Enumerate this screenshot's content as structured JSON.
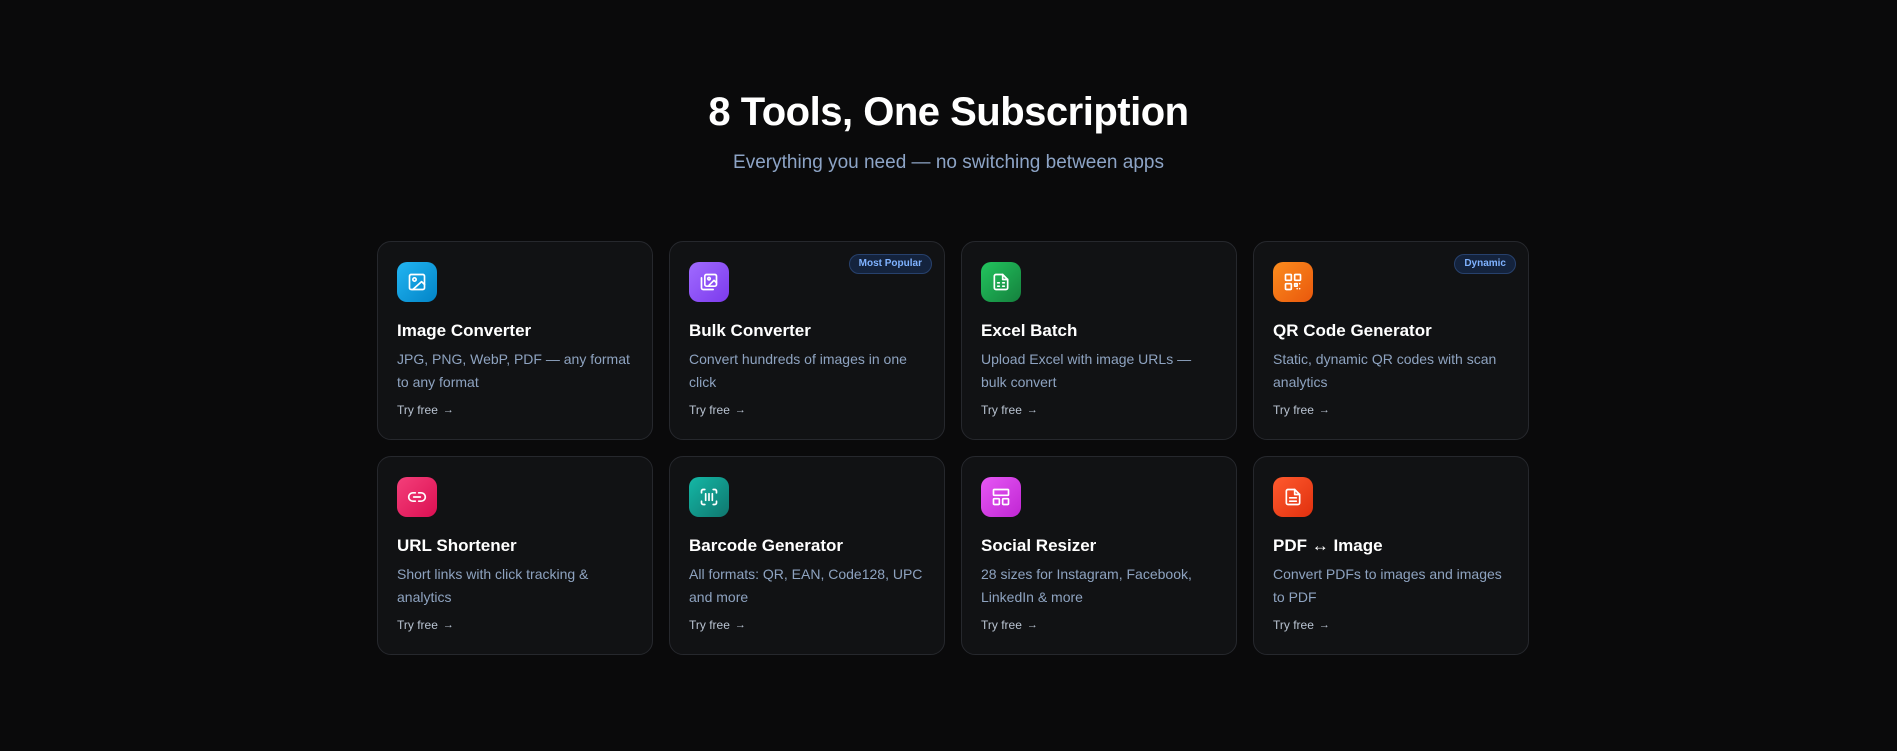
{
  "heading": "8 Tools, One Subscription",
  "subheading": "Everything you need — no switching between apps",
  "cta_label": "Try free",
  "cards": [
    {
      "title": "Image Converter",
      "description": "JPG, PNG, WebP, PDF — any format to any format",
      "icon": "image-icon",
      "color": "#0ea5e9",
      "badge": ""
    },
    {
      "title": "Bulk Converter",
      "description": "Convert hundreds of images in one click",
      "icon": "images-stack-icon",
      "color": "#8b5cf6",
      "badge": "Most Popular"
    },
    {
      "title": "Excel Batch",
      "description": "Upload Excel with image URLs — bulk convert",
      "icon": "spreadsheet-icon",
      "color": "#16a34a",
      "badge": ""
    },
    {
      "title": "QR Code Generator",
      "description": "Static, dynamic QR codes with scan analytics",
      "icon": "qr-code-icon",
      "color": "#f97316",
      "badge": "Dynamic"
    },
    {
      "title": "URL Shortener",
      "description": "Short links with click tracking & analytics",
      "icon": "link-icon",
      "color": "#e11d58",
      "badge": ""
    },
    {
      "title": "Barcode Generator",
      "description": "All formats: QR, EAN, Code128, UPC and more",
      "icon": "barcode-icon",
      "color": "#0d9488",
      "badge": ""
    },
    {
      "title": "Social Resizer",
      "description": "28 sizes for Instagram, Facebook, LinkedIn & more",
      "icon": "layout-icon",
      "color": "#d946ef",
      "badge": ""
    },
    {
      "title": "PDF ↔ Image",
      "description": "Convert PDFs to images and images to PDF",
      "icon": "document-icon",
      "color": "#ef4420",
      "badge": ""
    }
  ]
}
